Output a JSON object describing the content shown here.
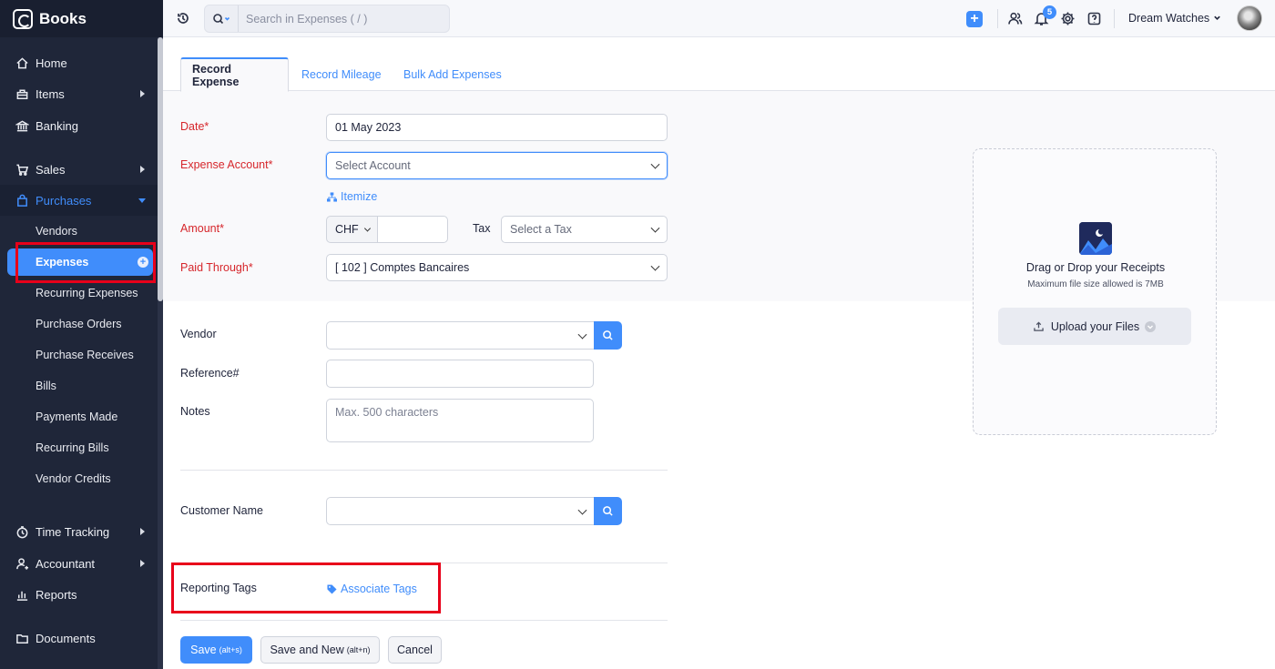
{
  "app": {
    "brand": "Books"
  },
  "sidebar": {
    "items": [
      {
        "label": "Home",
        "icon": "home-icon"
      },
      {
        "label": "Items",
        "icon": "items-icon"
      },
      {
        "label": "Banking",
        "icon": "bank-icon"
      },
      {
        "label": "Sales",
        "icon": "cart-icon"
      },
      {
        "label": "Purchases",
        "icon": "bag-icon"
      },
      {
        "label": "Time Tracking",
        "icon": "clock-icon"
      },
      {
        "label": "Accountant",
        "icon": "user-icon"
      },
      {
        "label": "Reports",
        "icon": "chart-icon"
      },
      {
        "label": "Documents",
        "icon": "folder-icon"
      }
    ],
    "purchases_sub": [
      "Vendors",
      "Expenses",
      "Recurring Expenses",
      "Purchase Orders",
      "Purchase Receives",
      "Bills",
      "Payments Made",
      "Recurring Bills",
      "Vendor Credits"
    ]
  },
  "topbar": {
    "search_placeholder": "Search in Expenses ( / )",
    "notification_count": "5",
    "org_name": "Dream Watches"
  },
  "tabs": [
    "Record Expense",
    "Record Mileage",
    "Bulk Add Expenses"
  ],
  "form": {
    "date_label": "Date*",
    "date_value": "01 May 2023",
    "account_label": "Expense Account*",
    "account_placeholder": "Select Account",
    "itemize_label": "Itemize",
    "amount_label": "Amount*",
    "currency": "CHF",
    "tax_label": "Tax",
    "tax_placeholder": "Select a Tax",
    "paid_label": "Paid Through*",
    "paid_value": "[ 102 ] Comptes Bancaires",
    "vendor_label": "Vendor",
    "reference_label": "Reference#",
    "notes_label": "Notes",
    "notes_placeholder": "Max. 500 characters",
    "customer_label": "Customer Name",
    "tags_label": "Reporting Tags",
    "tags_link": "Associate Tags"
  },
  "upload": {
    "title": "Drag or Drop your Receipts",
    "subtitle": "Maximum file size allowed is 7MB",
    "button": "Upload your Files"
  },
  "footer": {
    "save": "Save",
    "save_hint": "(alt+s)",
    "save_new": "Save and New",
    "save_new_hint": "(alt+n)",
    "cancel": "Cancel"
  },
  "colors": {
    "accent": "#408dfb",
    "sidebar": "#1f2639",
    "required": "#d6262b",
    "highlight": "#e8001a"
  }
}
